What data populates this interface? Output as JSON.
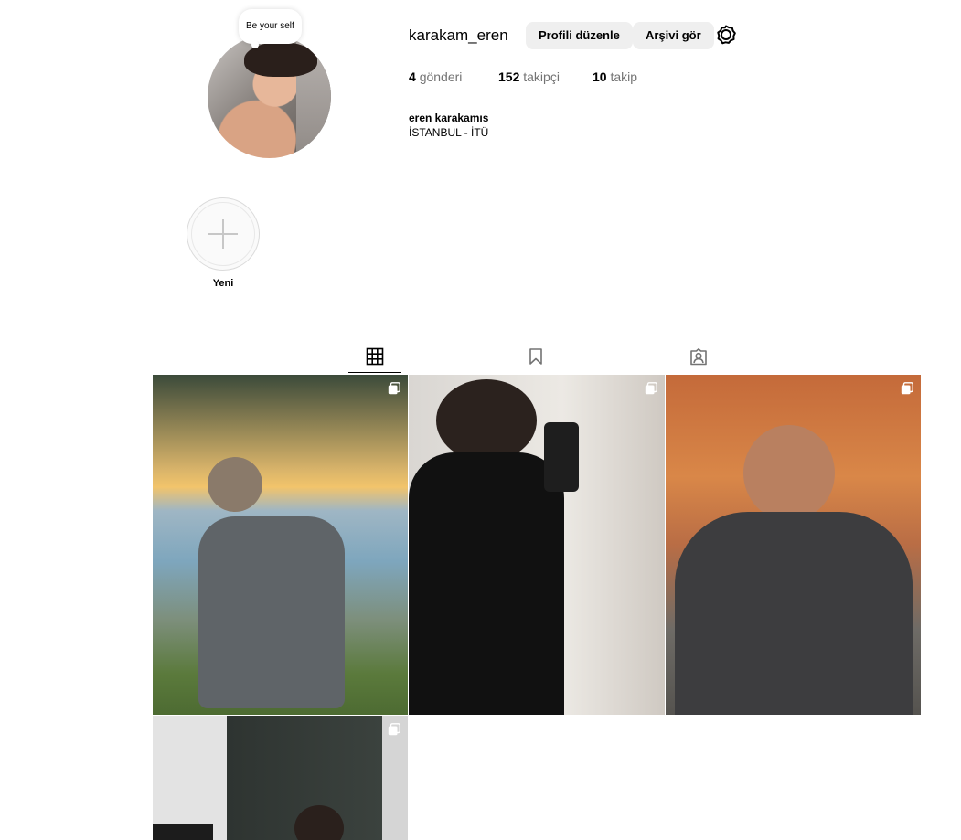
{
  "profile": {
    "note": "Be your self",
    "username": "karakam_eren",
    "edit_label": "Profili düzenle",
    "archive_label": "Arşivi gör",
    "stats": {
      "posts_count": "4",
      "posts_label": "gönderi",
      "followers_count": "152",
      "followers_label": "takipçi",
      "following_count": "10",
      "following_label": "takip"
    },
    "full_name": "eren karakamıs",
    "bio": "İSTANBUL - İTÜ"
  },
  "highlights": {
    "new_label": "Yeni"
  },
  "tabs": [
    {
      "icon": "grid-icon",
      "active": true
    },
    {
      "icon": "bookmark-icon",
      "active": false
    },
    {
      "icon": "tagged-icon",
      "active": false
    }
  ],
  "posts": [
    {
      "description": "photo",
      "multi": true
    },
    {
      "description": "photo",
      "multi": true
    },
    {
      "description": "photo",
      "multi": true
    },
    {
      "description": "photo",
      "multi": true
    }
  ],
  "colors": {
    "button_bg": "#efefef",
    "secondary_text": "#737373",
    "divider": "#dbdbdb"
  }
}
